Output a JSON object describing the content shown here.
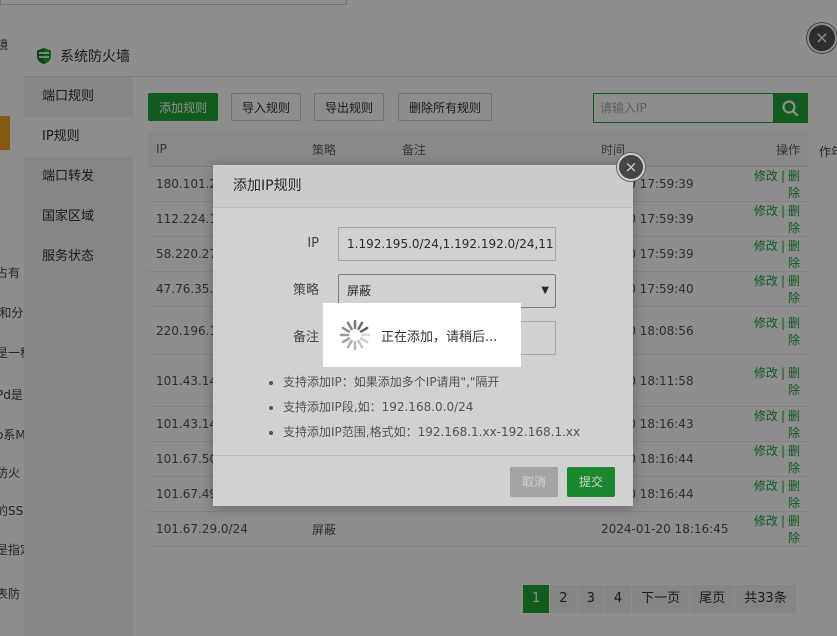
{
  "background": {
    "left_fragments": [
      "镜",
      "占有",
      "l和分",
      "是一种",
      "Pd是",
      "o系M",
      "防火",
      "的SS",
      "是指定",
      "表防"
    ],
    "right_fragments": [
      "作年"
    ]
  },
  "window": {
    "title": "系统防火墙",
    "close_label": "×"
  },
  "sidebar": {
    "items": [
      {
        "label": "端口规则"
      },
      {
        "label": "IP规则"
      },
      {
        "label": "端口转发"
      },
      {
        "label": "国家区域"
      },
      {
        "label": "服务状态"
      }
    ]
  },
  "toolbar": {
    "add_label": "添加规则",
    "import_label": "导入规则",
    "export_label": "导出规则",
    "delete_all_label": "删除所有规则",
    "search_placeholder": "请输入IP"
  },
  "table": {
    "headers": {
      "ip": "IP",
      "policy": "策略",
      "remark": "备注",
      "time": "时间",
      "ops": "操作"
    },
    "rows": [
      {
        "ip": "180.101.2",
        "policy": "",
        "time": "01-20 17:59:39"
      },
      {
        "ip": "112.224.1",
        "policy": "",
        "time": "01-20 17:59:39"
      },
      {
        "ip": "58.220.27",
        "policy": "",
        "time": "01-20 17:59:39"
      },
      {
        "ip": "47.76.35.0",
        "policy": "",
        "time": "01-20 17:59:40"
      },
      {
        "ip": "220.196.1",
        "policy": "",
        "time": "01-20 18:08:56"
      },
      {
        "ip": "101.43.14",
        "policy": "",
        "time": "01-20 18:11:58"
      },
      {
        "ip": "101.43.14",
        "policy": "",
        "time": "01-20 18:16:43"
      },
      {
        "ip": "101.67.50",
        "policy": "",
        "time": "01-20 18:16:44"
      },
      {
        "ip": "101.67.49",
        "policy": "",
        "time": "01-20 18:16:44"
      },
      {
        "ip": "101.67.29.0/24",
        "policy": "屏蔽",
        "time": "2024-01-20 18:16:45"
      }
    ],
    "edit_label": "修改",
    "sep": "|",
    "delete_label": "删除"
  },
  "pager": {
    "pages": [
      "1",
      "2",
      "3",
      "4"
    ],
    "next": "下一页",
    "last": "尾页",
    "total": "共33条"
  },
  "dialog": {
    "title": "添加IP规则",
    "close_label": "×",
    "ip_label": "IP",
    "ip_value": "1.192.195.0/24,1.192.192.0/24,11",
    "policy_label": "策略",
    "policy_value": "屏蔽",
    "remark_label": "备注",
    "tips": [
      "支持添加IP：如果添加多个IP请用\",\"隔开",
      "支持添加IP段,如：192.168.0.0/24",
      "支持添加IP范围,格式如：192.168.1.xx-192.168.1.xx"
    ],
    "cancel_label": "取消",
    "submit_label": "提交"
  },
  "loading": {
    "text": "正在添加，请稍后..."
  },
  "colors": {
    "accent": "#20a53a",
    "danger": "#ef0808"
  }
}
